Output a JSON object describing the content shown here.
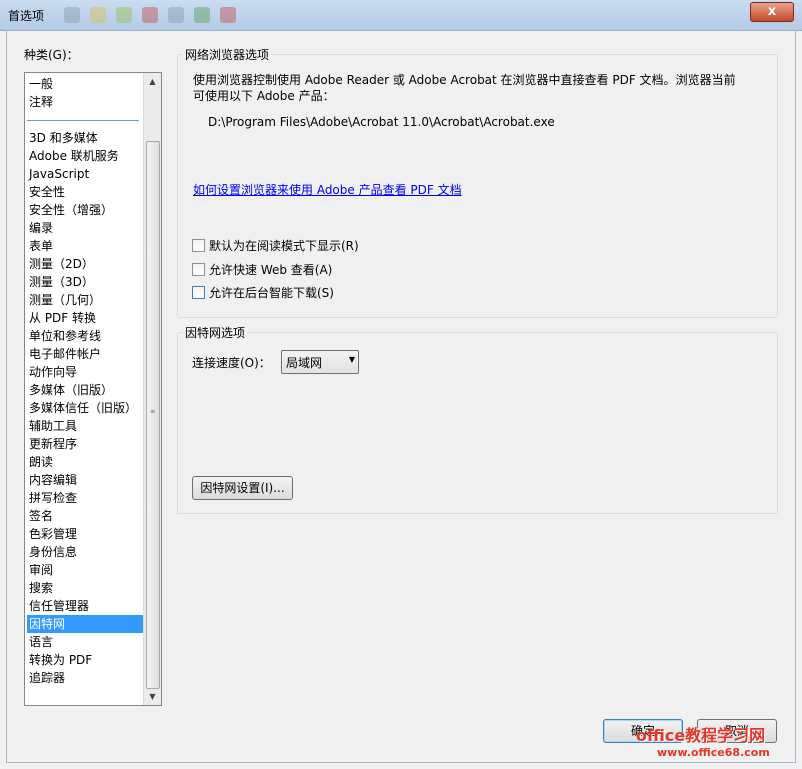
{
  "window": {
    "title": "首选项",
    "close_label": "x"
  },
  "sidebar": {
    "label": "种类(G)：",
    "top_items": [
      "一般",
      "注释"
    ],
    "items": [
      "3D 和多媒体",
      "Adobe 联机服务",
      "JavaScript",
      "安全性",
      "安全性（增强）",
      "编录",
      "表单",
      "测量（2D）",
      "测量（3D）",
      "测量（几何）",
      "从 PDF 转换",
      "单位和参考线",
      "电子邮件帐户",
      "动作向导",
      "多媒体（旧版）",
      "多媒体信任（旧版）",
      "辅助工具",
      "更新程序",
      "朗读",
      "内容编辑",
      "拼写检查",
      "签名",
      "色彩管理",
      "身份信息",
      "审阅",
      "搜索",
      "信任管理器",
      "因特网",
      "语言",
      "转换为 PDF",
      "追踪器"
    ],
    "selected": "因特网"
  },
  "browser_group": {
    "title": "网络浏览器选项",
    "description_line1": "使用浏览器控制使用 Adobe Reader 或 Adobe Acrobat 在浏览器中直接查看 PDF 文档。浏览器当前",
    "description_line2": "可使用以下 Adobe 产品：",
    "path": "D:\\Program Files\\Adobe\\Acrobat 11.0\\Acrobat\\Acrobat.exe",
    "link": "如何设置浏览器来使用 Adobe 产品查看 PDF 文档",
    "checkboxes": [
      {
        "label": "默认为在阅读模式下显示(R)",
        "checked": false
      },
      {
        "label": "允许快速 Web 查看(A)",
        "checked": false
      },
      {
        "label": "允许在后台智能下载(S)",
        "checked": false
      }
    ]
  },
  "internet_group": {
    "title": "因特网选项",
    "speed_label": "连接速度(O)：",
    "speed_value": "局域网",
    "settings_button": "因特网设置(I)..."
  },
  "footer": {
    "ok_label": "确定",
    "cancel_label": "取消"
  },
  "watermark": {
    "text": "office教程学习网",
    "url": "www.office68.com"
  },
  "colors": {
    "selection": "#3399ff",
    "link": "#0000ee",
    "watermark": "#e0382c"
  }
}
